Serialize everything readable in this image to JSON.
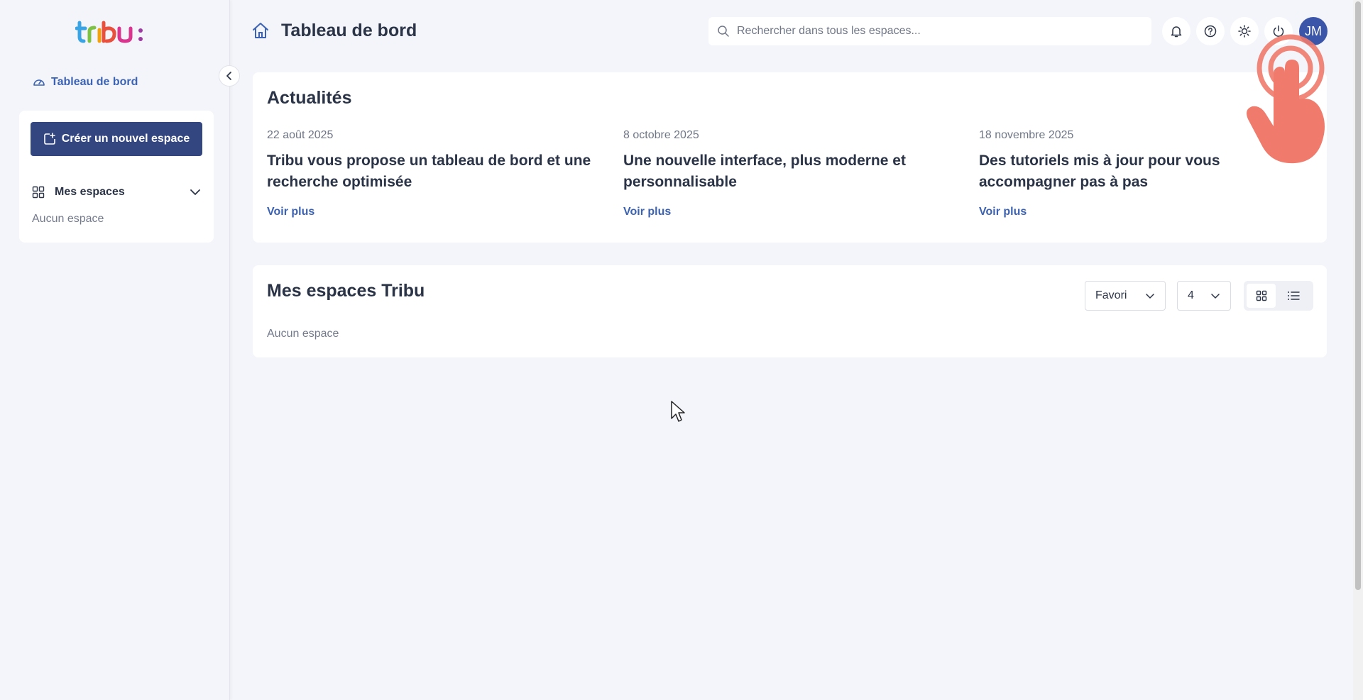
{
  "app": {
    "logo_text": "tribu:"
  },
  "colors": {
    "accent": "#334680",
    "link": "#3b62b3",
    "avatar_bg": "#3b55a8",
    "background": "#f4f5fa"
  },
  "sidebar": {
    "nav_dashboard": "Tableau de bord",
    "create_button": "Créer un nouvel espace",
    "my_spaces": "Mes espaces",
    "empty": "Aucun espace"
  },
  "header": {
    "title": "Tableau de bord",
    "search_placeholder": "Rechercher dans tous les espaces...",
    "avatar_initials": "JM",
    "icons": [
      "bell-icon",
      "help-icon",
      "sun-icon",
      "power-icon"
    ]
  },
  "news": {
    "title": "Actualités",
    "items": [
      {
        "date": "22 août 2025",
        "title": "Tribu vous propose un tableau de bord et une recherche optimisée",
        "link": "Voir plus"
      },
      {
        "date": "8 octobre 2025",
        "title": "Une nouvelle interface, plus moderne et personnalisable",
        "link": "Voir plus"
      },
      {
        "date": "18 novembre 2025",
        "title": "Des tutoriels mis à jour pour vous accompagner pas à pas",
        "link": "Voir plus"
      }
    ]
  },
  "spaces": {
    "title": "Mes espaces Tribu",
    "sort_value": "Favori",
    "count_value": "4",
    "view_mode": "grid",
    "empty": "Aucun espace"
  }
}
